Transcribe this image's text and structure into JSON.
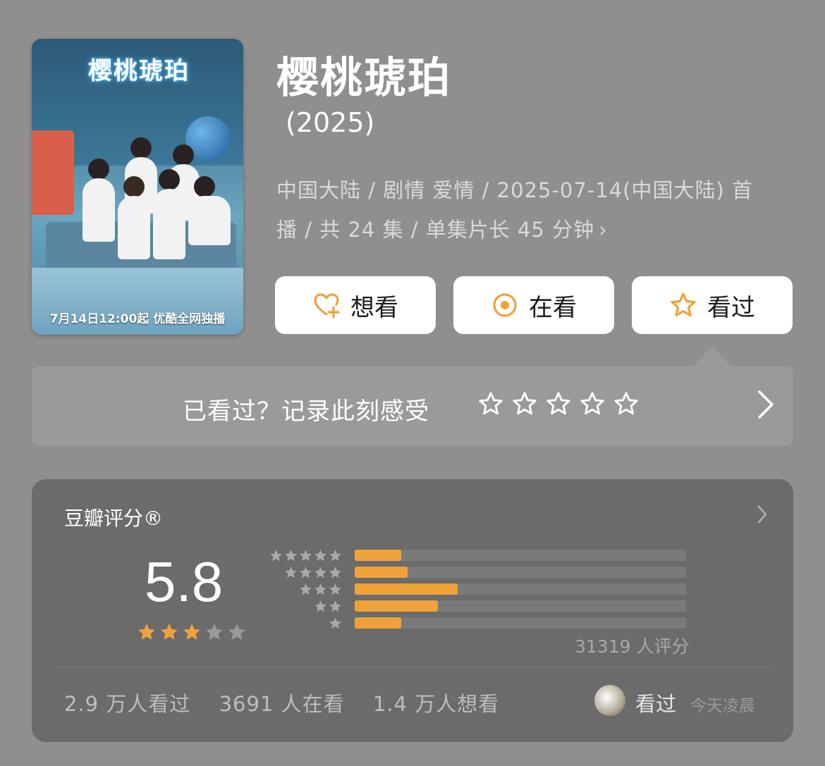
{
  "poster": {
    "title_text": "樱桃琥珀",
    "caption": "7月14日12:00起 优酷全网独播"
  },
  "title": "樱桃琥珀",
  "year": "(2025)",
  "meta": {
    "line1": "中国大陆 / 剧情 爱情 / 2025-07-14(中国大陆) 首",
    "line2": "播 / 共 24 集 / 单集片长 45 分钟",
    "chevron": "›"
  },
  "actions": {
    "want": {
      "label": "想看",
      "icon": "heart-plus-icon"
    },
    "watching": {
      "label": "在看",
      "icon": "target-icon"
    },
    "watched": {
      "label": "看过",
      "icon": "star-outline-icon"
    }
  },
  "record": {
    "prompt": "已看过？记录此刻感受",
    "star_count": 5
  },
  "rating": {
    "header": "豆瓣评分®",
    "score": "5.8",
    "stars_filled": 3,
    "stars_total": 5,
    "distribution": [
      {
        "stars": 5,
        "fraction": 0.14
      },
      {
        "stars": 4,
        "fraction": 0.16
      },
      {
        "stars": 3,
        "fraction": 0.31
      },
      {
        "stars": 2,
        "fraction": 0.25
      },
      {
        "stars": 1,
        "fraction": 0.14
      }
    ],
    "count": "31319 人评分",
    "stats": {
      "watched": "2.9 万人看过",
      "watching": "3691 人在看",
      "want": "1.4 万人想看"
    },
    "user_status": "看过",
    "user_time": "今天凌晨"
  },
  "colors": {
    "background": "#8f8f8f",
    "accent": "#f0a23a",
    "card": "#6b6b6b"
  }
}
